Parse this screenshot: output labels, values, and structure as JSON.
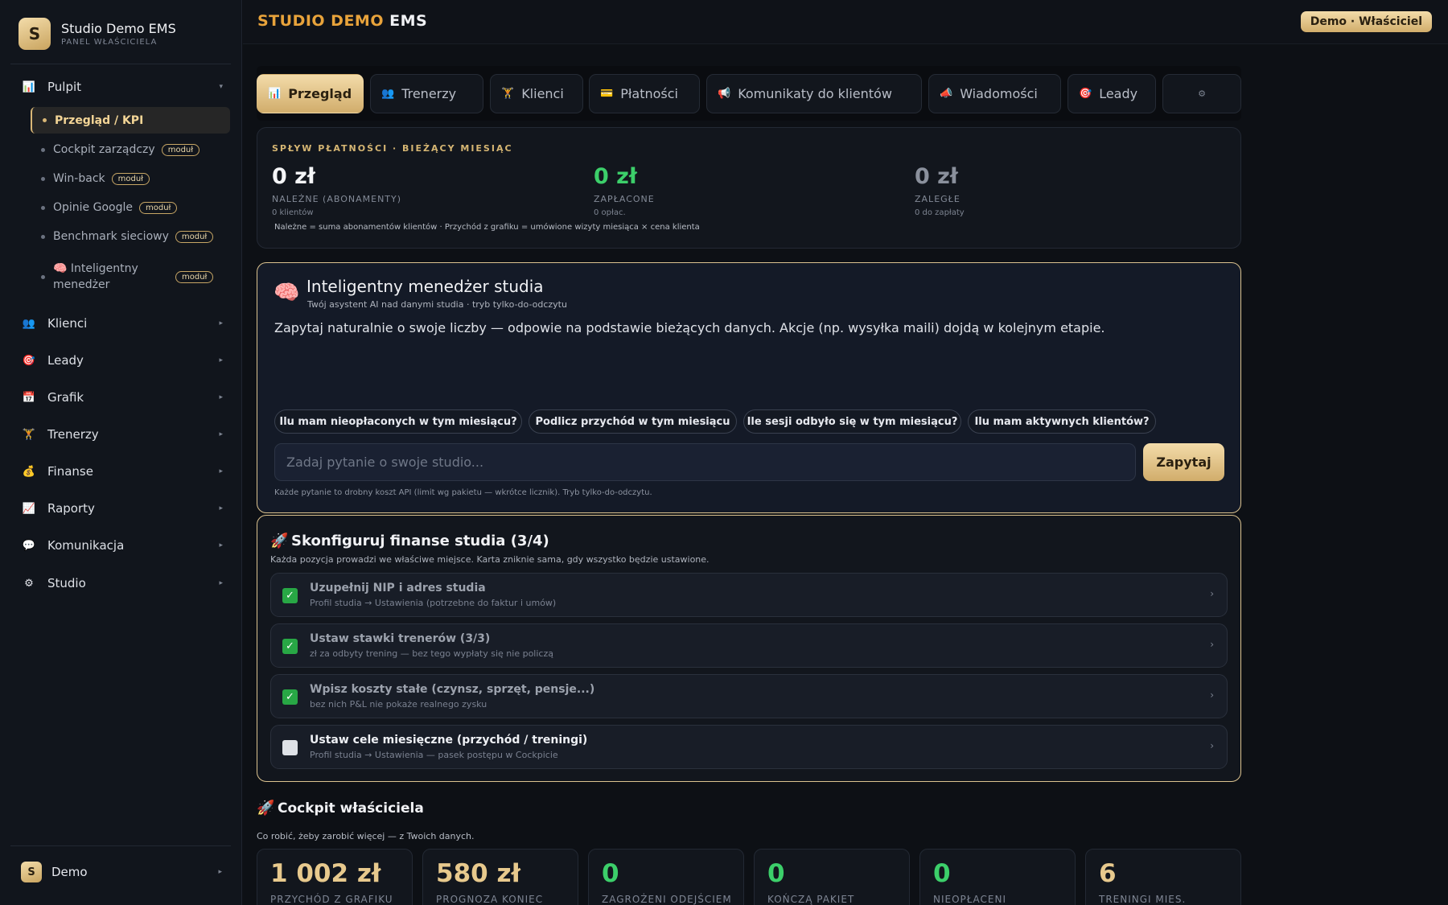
{
  "brand": {
    "logo": "S",
    "name": "Studio Demo EMS",
    "subtitle": "PANEL WŁAŚCICIELA"
  },
  "sidebar": {
    "top": {
      "label": "Pulpit",
      "icon": "📊"
    },
    "sub_items": [
      {
        "label": "Przegląd / KPI",
        "active": true
      },
      {
        "label": "Cockpit zarządczy",
        "badge": "moduł"
      },
      {
        "label": "Win-back",
        "badge": "moduł"
      },
      {
        "label": "Opinie Google",
        "badge": "moduł"
      },
      {
        "label": "Benchmark sieciowy",
        "badge": "moduł"
      },
      {
        "label": "🧠 Inteligentny",
        "label2": "menedżer",
        "badge": "moduł"
      }
    ],
    "items": [
      {
        "label": "Klienci",
        "icon": "👥"
      },
      {
        "label": "Leady",
        "icon": "🎯"
      },
      {
        "label": "Grafik",
        "icon": "📅"
      },
      {
        "label": "Trenerzy",
        "icon": "🏋"
      },
      {
        "label": "Finanse",
        "icon": "💰"
      },
      {
        "label": "Raporty",
        "icon": "📈"
      },
      {
        "label": "Komunikacja",
        "icon": "💬"
      },
      {
        "label": "Studio",
        "icon": "⚙"
      }
    ],
    "user": {
      "avatar": "S",
      "name": "Demo"
    }
  },
  "header": {
    "title_accent": "STUDIO DEMO",
    "title_rest": "EMS",
    "role": "Demo · Właściciel"
  },
  "tabs": [
    {
      "label": "Przegląd",
      "icon": "📊",
      "active": true
    },
    {
      "label": "Trenerzy",
      "icon": "👥"
    },
    {
      "label": "Klienci",
      "icon": "🏋"
    },
    {
      "label": "Płatności",
      "icon": "💳"
    },
    {
      "label": "Komunikaty do klientów",
      "icon": "📢"
    },
    {
      "label": "Wiadomości",
      "icon": "📣"
    },
    {
      "label": "Leady",
      "icon": "🎯"
    },
    {
      "label": "",
      "icon": "⚙"
    }
  ],
  "payments": {
    "eyebrow": "SPŁYW PŁATNOŚCI · BIEŻĄCY MIESIĄC",
    "kpis": [
      {
        "value": "0 zł",
        "label": "NALEŻNE (ABONAMENTY)",
        "sub": "0 klientów",
        "color": "#f4f5f7"
      },
      {
        "value": "0 zł",
        "label": "ZAPŁACONE",
        "sub": "0 opłac.",
        "color": "#3ccf6a"
      },
      {
        "value": "0 zł",
        "label": "ZALEGŁE",
        "sub": "0 do zapłaty",
        "color": "#8a909c"
      }
    ],
    "note": "Należne = suma abonamentów klientów · Przychód z grafiku = umówione wizyty miesiąca × cena klienta"
  },
  "ai": {
    "icon": "🧠",
    "title": "Inteligentny menedżer studia",
    "subtitle": "Twój asystent AI nad danymi studia · tryb tylko-do-odczytu",
    "intro": "Zapytaj naturalnie o swoje liczby — odpowie na podstawie bieżących danych. Akcje (np. wysyłka maili) dojdą w kolejnym etapie.",
    "chips": [
      "Ilu mam nieopłaconych w tym miesiącu?",
      "Podlicz przychód w tym miesiącu",
      "Ile sesji odbyło się w tym miesiącu?",
      "Ilu mam aktywnych klientów?"
    ],
    "placeholder": "Zadaj pytanie o swoje studio...",
    "button": "Zapytaj",
    "footer": "Każde pytanie to drobny koszt API (limit wg pakietu — wkrótce licznik). Tryb tylko-do-odczytu."
  },
  "setup": {
    "icon": "🚀",
    "title": "Skonfiguruj finanse studia (3/4)",
    "subtitle": "Każda pozycja prowadzi we właściwe miejsce. Karta zniknie sama, gdy wszystko będzie ustawione.",
    "tasks": [
      {
        "title": "Uzupełnij NIP i adres studia",
        "desc": "Profil studia → Ustawienia (potrzebne do faktur i umów)",
        "done": true
      },
      {
        "title": "Ustaw stawki trenerów (3/3)",
        "desc": "zł za odbyty trening — bez tego wypłaty się nie policzą",
        "done": true
      },
      {
        "title": "Wpisz koszty stałe (czynsz, sprzęt, pensje...)",
        "desc": "bez nich P&L nie pokaże realnego zysku",
        "done": true
      },
      {
        "title": "Ustaw cele miesięczne (przychód / treningi)",
        "desc": "Profil studia → Ustawienia — pasek postępu w Cockpicie",
        "done": false
      }
    ]
  },
  "cockpit": {
    "icon": "🚀",
    "title": "Cockpit właściciela",
    "subtitle": "Co robić, żeby zarobić więcej — z Twoich danych.",
    "stats": [
      {
        "value": "1 002 zł",
        "label": "PRZYCHÓD Z GRAFIKU",
        "color": "#e7c98d"
      },
      {
        "value": "580 zł",
        "label": "PROGNOZA KONIEC",
        "color": "#e7c98d"
      },
      {
        "value": "0",
        "label": "ZAGROŻENI ODEJŚCIEM",
        "color": "#3ccf6a"
      },
      {
        "value": "0",
        "label": "KOŃCZĄ PAKIET",
        "color": "#3ccf6a"
      },
      {
        "value": "0",
        "label": "NIEOPŁACENI",
        "color": "#3ccf6a"
      },
      {
        "value": "6",
        "label": "TRENINGI MIES.",
        "color": "#e7c98d"
      }
    ]
  }
}
